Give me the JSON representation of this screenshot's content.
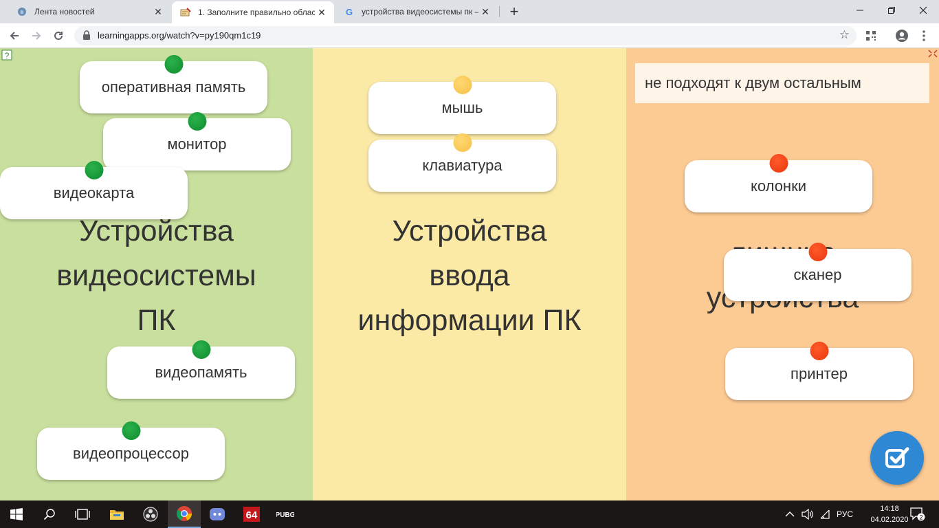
{
  "browser": {
    "tabs": [
      {
        "title": "Лента новостей",
        "active": false
      },
      {
        "title": "1. Заполните правильно област",
        "active": true
      },
      {
        "title": "устройства видеосистемы пк – ",
        "active": false
      }
    ],
    "url": "learningapps.org/watch?v=py190qm1c19"
  },
  "app": {
    "columns": [
      {
        "heading_lines": [
          "Устройства",
          "видеосистемы",
          "ПК"
        ]
      },
      {
        "heading_lines": [
          "Устройства",
          "ввода",
          "информации ПК"
        ]
      },
      {
        "heading_lines": [
          "лишние",
          "устройства"
        ]
      }
    ],
    "note": "не подходят к двум остальным",
    "cards": [
      {
        "label": "оперативная память",
        "dot_color": "green"
      },
      {
        "label": "монитор",
        "dot_color": "green"
      },
      {
        "label": "видеокарта",
        "dot_color": "green"
      },
      {
        "label": "видеопамять",
        "dot_color": "green"
      },
      {
        "label": "видеопроцессор",
        "dot_color": "green"
      },
      {
        "label": "мышь",
        "dot_color": "yellow"
      },
      {
        "label": "клавиатура",
        "dot_color": "yellow"
      },
      {
        "label": "колонки",
        "dot_color": "red"
      },
      {
        "label": "сканер",
        "dot_color": "red"
      },
      {
        "label": "принтер",
        "dot_color": "red"
      }
    ],
    "colors": {
      "green": "#c9df9e",
      "yellow": "#fbe9a6",
      "orange": "#fcca93",
      "check_button": "#2f88d4"
    }
  },
  "taskbar": {
    "apps": [
      "start",
      "search",
      "task-view",
      "file-explorer",
      "obs",
      "chrome",
      "discord",
      "aida64",
      "pubg"
    ],
    "tray": {
      "lang": "РУС",
      "time": "14:18",
      "date": "04.02.2020",
      "notifications": "2"
    }
  }
}
